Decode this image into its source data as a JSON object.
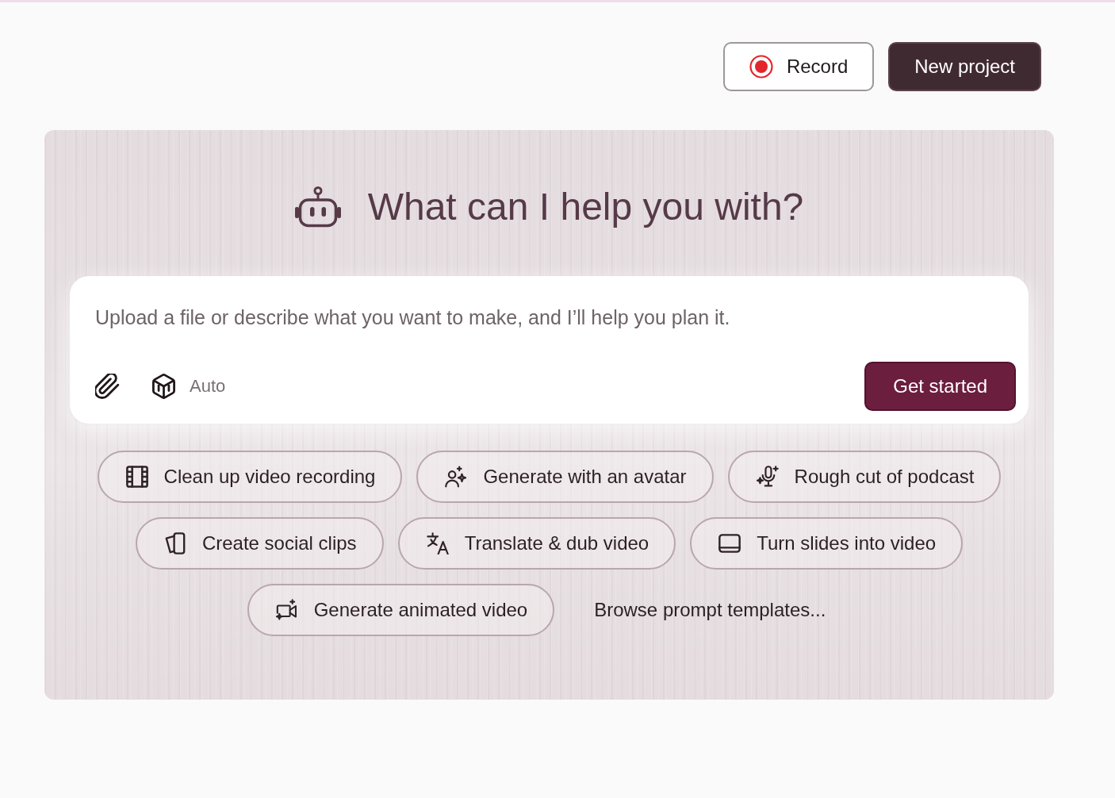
{
  "header": {
    "buttons": [
      {
        "label": "Record",
        "kind": "record"
      },
      {
        "label": "New project",
        "kind": "primary"
      }
    ]
  },
  "assistant": {
    "title": "What can I help you with?",
    "prompt": {
      "placeholder": "Upload a file or describe what you want to make, and I’ll help you plan it.",
      "mode": "Auto",
      "submit": "Get started"
    },
    "suggestions": [
      {
        "label": "Clean up video recording",
        "kind": "chip"
      },
      {
        "label": "Generate with an avatar",
        "kind": "chip"
      },
      {
        "label": "Rough cut of podcast",
        "kind": "chip"
      },
      {
        "label": "Create social clips",
        "kind": "chip"
      },
      {
        "label": "Translate & dub video",
        "kind": "chip"
      },
      {
        "label": "Turn slides into video",
        "kind": "chip"
      },
      {
        "label": "Generate animated video",
        "kind": "chip"
      },
      {
        "label": "Browse prompt templates...",
        "kind": "link"
      }
    ]
  }
}
